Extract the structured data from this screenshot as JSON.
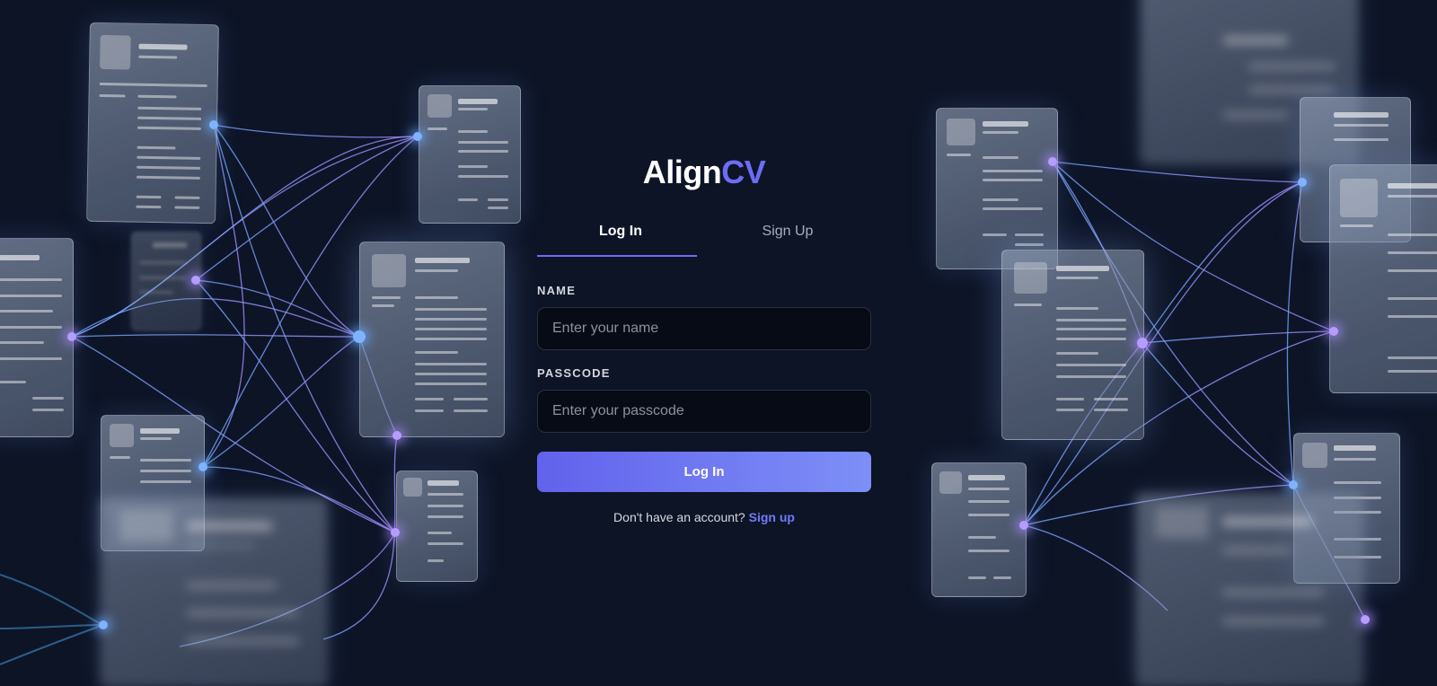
{
  "brand": {
    "name_primary": "Align",
    "name_accent": "CV",
    "accent_color": "#6e6cf6"
  },
  "tabs": [
    {
      "label": "Log In",
      "active": true
    },
    {
      "label": "Sign Up",
      "active": false
    }
  ],
  "form": {
    "name_label": "NAME",
    "name_placeholder": "Enter your name",
    "name_value": "",
    "passcode_label": "PASSCODE",
    "passcode_placeholder": "Enter your passcode",
    "passcode_value": "",
    "submit_label": "Log In"
  },
  "footer": {
    "prompt": "Don't have an account?",
    "link_label": "Sign up"
  },
  "colors": {
    "background": "#0d1426",
    "button_gradient_start": "#6262ec",
    "button_gradient_end": "#7d8ff7",
    "link": "#6e7cf8"
  }
}
